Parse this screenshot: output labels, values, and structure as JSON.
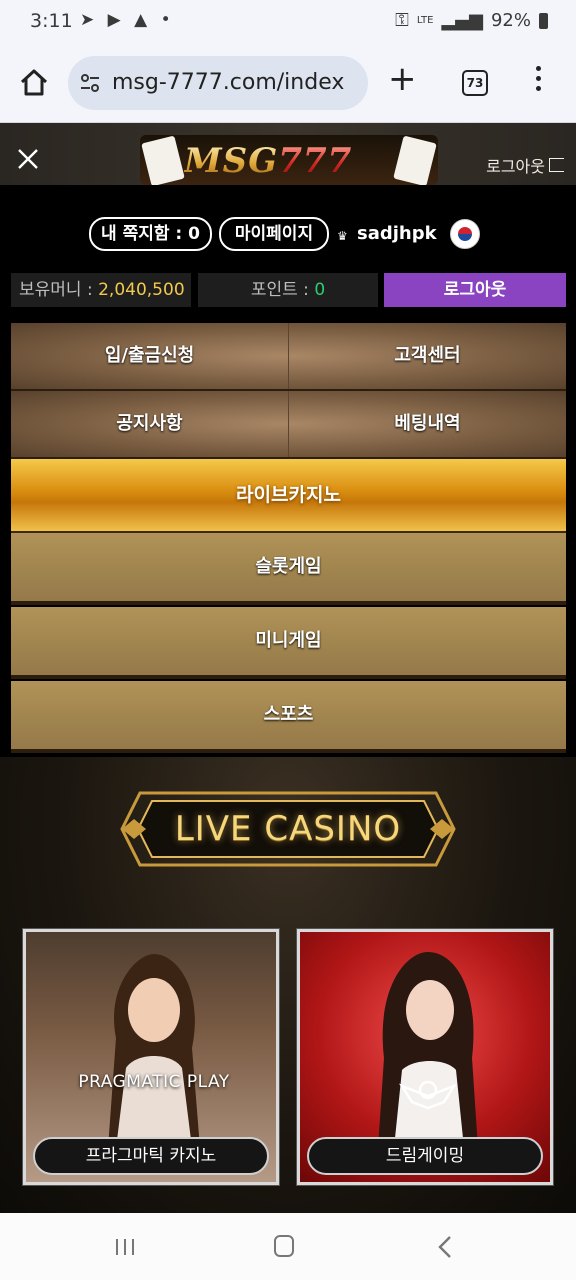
{
  "status_bar": {
    "time": "3:11",
    "status_icons": "telegram-icon youtube-icon warning-icon dot-icon",
    "network": "LTE",
    "battery": "92%"
  },
  "browser": {
    "url": "msg-7777.com/index",
    "tab_count": "73"
  },
  "site": {
    "logo_text_left": "MSG",
    "logo_text_right": "777",
    "header_logout": "로그아웃"
  },
  "user": {
    "messages_pill": "내 쪽지함 : 0",
    "mypage_pill": "마이페이지",
    "username": "sadjhpk",
    "money_label": "보유머니 : ",
    "money_value": "2,040,500",
    "point_label": "포인트 : ",
    "point_value": "0",
    "logout_button": "로그아웃"
  },
  "menu": {
    "deposit_withdraw": "입/출금신청",
    "customer_center": "고객센터",
    "notice": "공지사항",
    "bet_history": "베팅내역",
    "live_casino": "라이브카지노",
    "slot_game": "슬롯게임",
    "mini_game": "미니게임",
    "sports": "스포츠"
  },
  "banner": {
    "title": "LIVE CASINO"
  },
  "games": [
    {
      "label": "프라그마틱 카지노",
      "provider_logo": "PRAGMATIC PLAY"
    },
    {
      "label": "드림게이밍"
    }
  ],
  "colors": {
    "accent_purple": "#8a44c2",
    "money_gold": "#f2c94c",
    "point_green": "#2ecc71",
    "live_gold": "#d98d10"
  }
}
